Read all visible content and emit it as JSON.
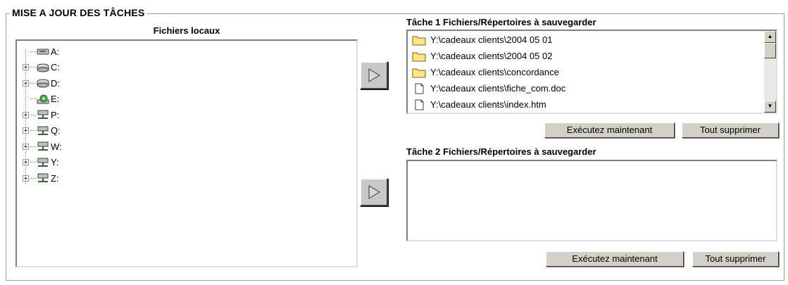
{
  "group": {
    "title": "MISE A JOUR DES TÂCHES"
  },
  "local": {
    "title": "Fichiers locaux",
    "drives": [
      {
        "label": "A:",
        "icon": "floppy-drive-icon",
        "expandable": false
      },
      {
        "label": "C:",
        "icon": "hard-drive-icon",
        "expandable": true
      },
      {
        "label": "D:",
        "icon": "hard-drive-icon",
        "expandable": true
      },
      {
        "label": "E:",
        "icon": "cd-drive-icon",
        "expandable": false
      },
      {
        "label": "P:",
        "icon": "network-drive-icon",
        "expandable": true
      },
      {
        "label": "Q:",
        "icon": "network-drive-icon",
        "expandable": true
      },
      {
        "label": "W:",
        "icon": "network-drive-icon",
        "expandable": true
      },
      {
        "label": "Y:",
        "icon": "network-drive-icon",
        "expandable": true
      },
      {
        "label": "Z:",
        "icon": "network-drive-icon",
        "expandable": true
      }
    ]
  },
  "task1": {
    "title": "Tâche 1 Fichiers/Répertoires à sauvegarder",
    "items": [
      {
        "label": "Y:\\cadeaux clients\\2004 05 01",
        "icon": "folder-icon"
      },
      {
        "label": "Y:\\cadeaux clients\\2004 05 02",
        "icon": "folder-icon"
      },
      {
        "label": "Y:\\cadeaux clients\\concordance",
        "icon": "folder-icon"
      },
      {
        "label": "Y:\\cadeaux clients\\fiche_com.doc",
        "icon": "file-icon"
      },
      {
        "label": "Y:\\cadeaux clients\\index.htm",
        "icon": "file-icon"
      }
    ],
    "execute_label": "Exécutez maintenant",
    "delete_label": "Tout supprimer"
  },
  "task2": {
    "title": "Tâche 2 Fichiers/Répertoires à sauvegarder",
    "items": [],
    "execute_label": "Exécutez maintenant",
    "delete_label": "Tout supprimer"
  },
  "icons": {
    "add_arrow": "play-arrow-icon",
    "scroll_up": "scroll-up-icon",
    "scroll_down": "scroll-down-icon"
  },
  "colors": {
    "button_face": "#d4d0c8",
    "folder": "#ffe680",
    "network_drive": "#4c9a3a"
  }
}
